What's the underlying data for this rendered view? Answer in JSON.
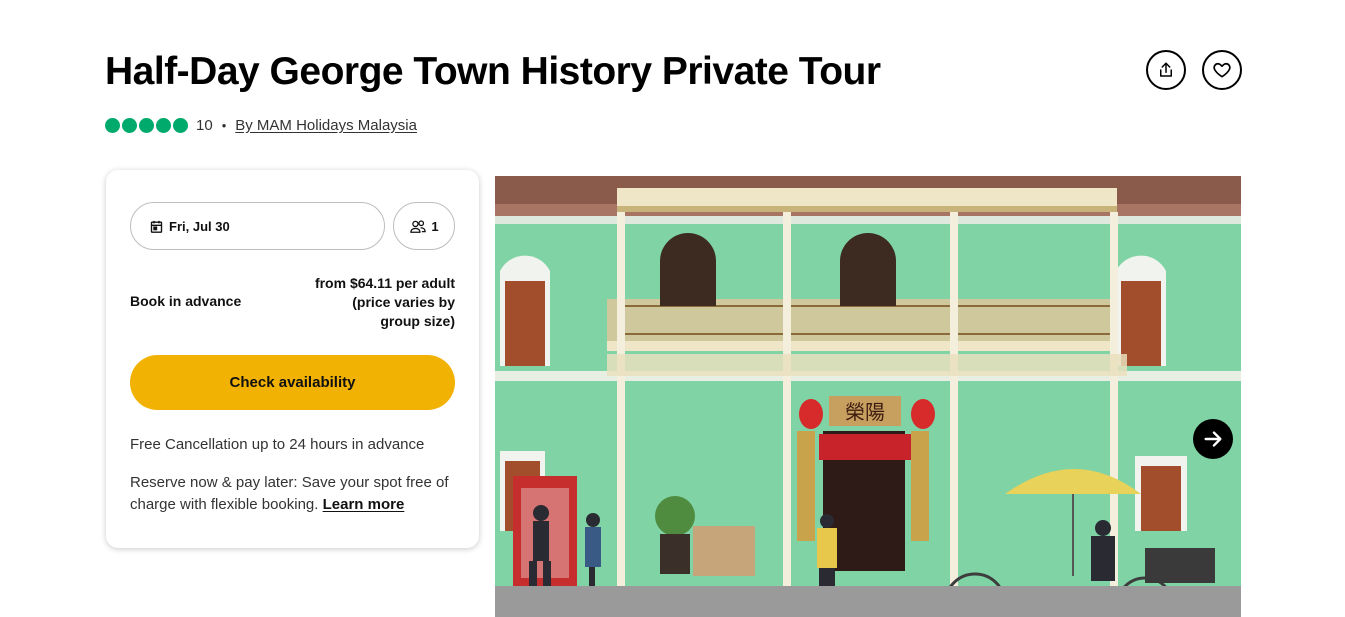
{
  "tour": {
    "title": "Half-Day George Town History Private Tour",
    "rating_bubbles": 5,
    "review_count": "10",
    "separator": "•",
    "operator": "By MAM Holidays Malaysia"
  },
  "header_actions": {
    "share_icon": "share-icon",
    "favorite_icon": "heart-icon"
  },
  "booking": {
    "date": "Fri, Jul 30",
    "travelers": "1",
    "book_label": "Book in advance",
    "price_line1": "from $64.11 per adult",
    "price_line2": "(price varies by",
    "price_line3": "group size)",
    "cta": "Check availability",
    "free_cancellation": "Free Cancellation up to 24 hours in advance",
    "reserve_text": "Reserve now & pay later: Save your spot free of charge with flexible booking.",
    "learn_more": "Learn more"
  },
  "gallery": {
    "sign_text": "榮陽",
    "next_icon": "arrow-right-icon"
  },
  "colors": {
    "rating_green": "#00aa6c",
    "cta_yellow": "#f2b203",
    "building_green": "#7fd3a5"
  }
}
